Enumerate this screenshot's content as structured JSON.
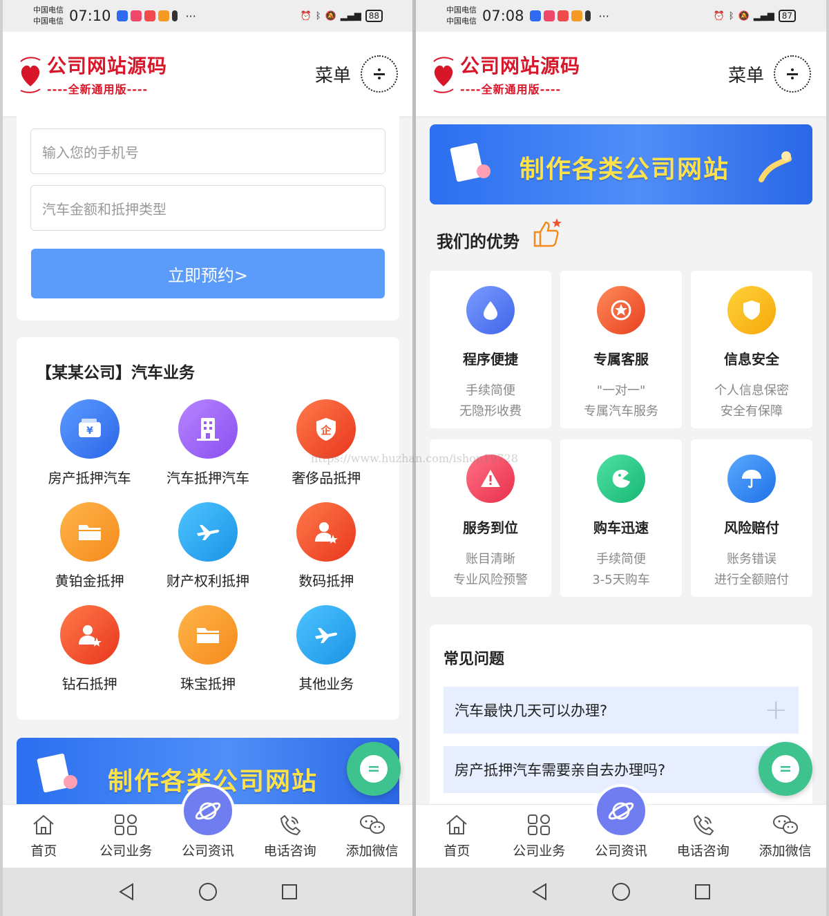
{
  "left": {
    "status": {
      "carrier1": "中国电信",
      "carrier2": "中国电信",
      "time": "07:10",
      "battery": "88"
    },
    "header": {
      "logo_title": "公司网站源码",
      "logo_sub": "----全新通用版----",
      "menu_label": "菜单"
    },
    "form": {
      "phone_placeholder": "输入您的手机号",
      "amount_placeholder": "汽车金额和抵押类型",
      "submit_label": "立即预约>"
    },
    "business": {
      "title": "【某某公司】汽车业务",
      "items": [
        {
          "label": "房产抵押汽车",
          "icon": "wallet-icon",
          "color": "#3a7af2"
        },
        {
          "label": "汽车抵押汽车",
          "icon": "building-icon",
          "color": "#9b5ff0"
        },
        {
          "label": "奢侈品抵押",
          "icon": "enterprise-shield-icon",
          "color": "#f2542d"
        },
        {
          "label": "黄铂金抵押",
          "icon": "folder-icon",
          "color": "#f59b23"
        },
        {
          "label": "财产权利抵押",
          "icon": "airplane-icon",
          "color": "#1aa7ec"
        },
        {
          "label": "数码抵押",
          "icon": "user-star-icon",
          "color": "#f2542d"
        },
        {
          "label": "钻石抵押",
          "icon": "user-star-icon",
          "color": "#f2542d"
        },
        {
          "label": "珠宝抵押",
          "icon": "folder-icon",
          "color": "#f59b23"
        },
        {
          "label": "其他业务",
          "icon": "airplane-icon",
          "color": "#1aa7ec"
        }
      ]
    },
    "banner_text": "制作各类公司网站"
  },
  "right": {
    "status": {
      "carrier1": "中国电信",
      "carrier2": "中国电信",
      "time": "07:08",
      "battery": "87"
    },
    "header": {
      "logo_title": "公司网站源码",
      "logo_sub": "----全新通用版----",
      "menu_label": "菜单"
    },
    "banner_text": "制作各类公司网站",
    "advantages": {
      "title": "我们的优势",
      "items": [
        {
          "title": "程序便捷",
          "line1": "手续简便",
          "line2": "无隐形收费",
          "icon": "drop-icon",
          "color": "#4f78f0"
        },
        {
          "title": "专属客服",
          "line1": "\"一对一\"",
          "line2": "专属汽车服务",
          "icon": "star-badge-icon",
          "color": "#f0563a"
        },
        {
          "title": "信息安全",
          "line1": "个人信息保密",
          "line2": "安全有保障",
          "icon": "shield-icon",
          "color": "#f7b90f"
        },
        {
          "title": "服务到位",
          "line1": "账目清晰",
          "line2": "专业风险预警",
          "icon": "warning-icon",
          "color": "#f1455a"
        },
        {
          "title": "购车迅速",
          "line1": "手续简便",
          "line2": "3-5天购车",
          "icon": "pacman-icon",
          "color": "#2dc98a"
        },
        {
          "title": "风险赔付",
          "line1": "账务错误",
          "line2": "进行全额赔付",
          "icon": "umbrella-icon",
          "color": "#2f86f0"
        }
      ]
    },
    "faq": {
      "title": "常见问题",
      "items": [
        {
          "q": "汽车最快几天可以办理?"
        },
        {
          "q": "房产抵押汽车需要亲自去办理吗?"
        }
      ]
    }
  },
  "tabbar": {
    "items": [
      {
        "label": "首页",
        "icon": "home-icon"
      },
      {
        "label": "公司业务",
        "icon": "grid-icon"
      },
      {
        "label": "公司资讯",
        "icon": "planet-icon"
      },
      {
        "label": "电话咨询",
        "icon": "phone-icon"
      },
      {
        "label": "添加微信",
        "icon": "wechat-icon"
      }
    ]
  },
  "watermark": "https://www.huzhan.com/ishop19728"
}
